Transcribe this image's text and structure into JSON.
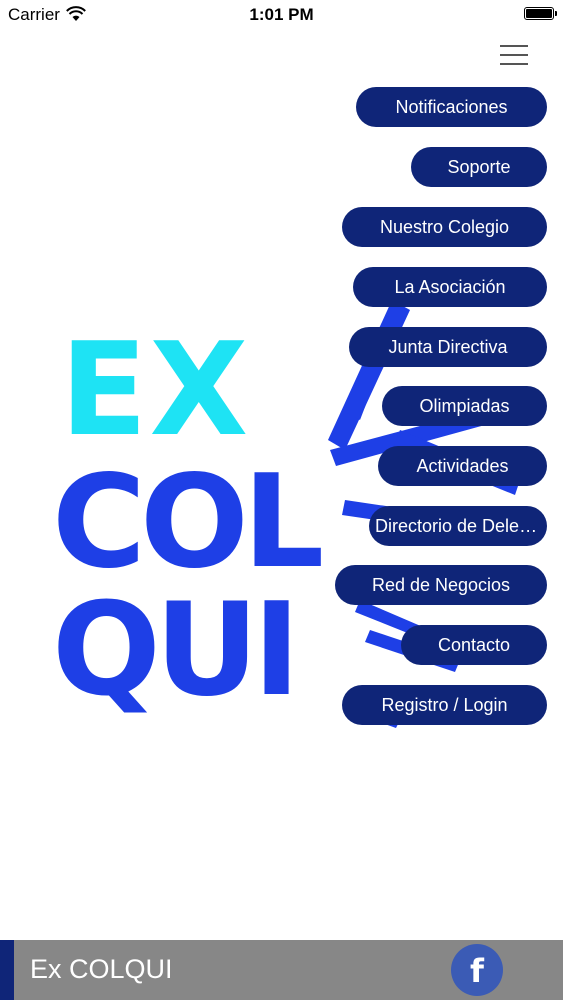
{
  "status_bar": {
    "carrier": "Carrier",
    "time": "1:01 PM"
  },
  "logo": {
    "line1": "EX",
    "line2": "COL",
    "line3": "QUI",
    "color_top": "#1ee3f4",
    "color_main": "#1e3fe6"
  },
  "menu": {
    "items": [
      {
        "label": "Notificaciones"
      },
      {
        "label": "Soporte"
      },
      {
        "label": "Nuestro Colegio"
      },
      {
        "label": "La Asociación"
      },
      {
        "label": "Junta Directiva"
      },
      {
        "label": "Olimpiadas"
      },
      {
        "label": "Actividades"
      },
      {
        "label": "Directorio de Delegados"
      },
      {
        "label": "Red de Negocios"
      },
      {
        "label": "Contacto"
      },
      {
        "label": "Registro / Login"
      }
    ],
    "button_color": "#0f2578"
  },
  "footer": {
    "title": "Ex COLQUI",
    "facebook_icon": "f"
  }
}
